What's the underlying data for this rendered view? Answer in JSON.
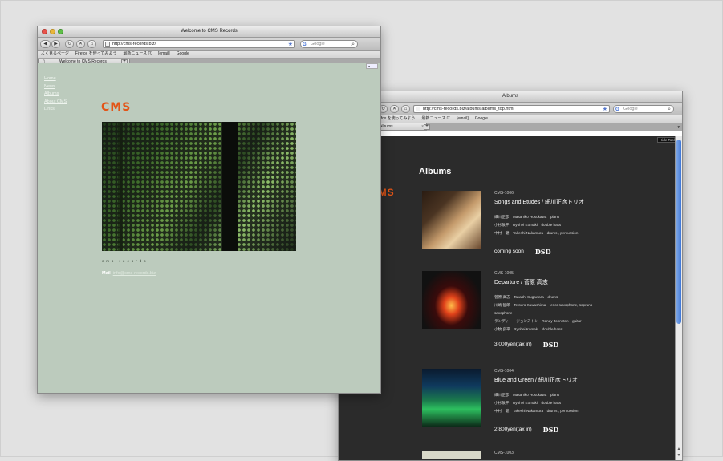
{
  "back_window": {
    "title": "Albums",
    "url": "http://cms-records.biz/albums/albums_top.html",
    "search_placeholder": "Google",
    "bookmarks": [
      "Firefox を使ってみよう",
      "最新ニュース ☈",
      "[email]",
      "Google"
    ],
    "tab_label": "Albums",
    "hide_tools": "Hide Tools",
    "heading": "Albums",
    "logo": "CMS",
    "albums": [
      {
        "catalog": "CMS-1006",
        "title": "Songs and Etudes / 細川正彦トリオ",
        "members": [
          "細川正彦　Masahiko Hosokawa　piano",
          "小杉敏平　Ryohei Komaki　double bass",
          "中村　健　Takeshi Nakamura　drums , percussion"
        ],
        "price": "coming soon",
        "dsd": "DSD"
      },
      {
        "catalog": "CMS-1005",
        "title": "Departure / 菅原 高志",
        "members": [
          "菅原 高志　Takashi Sugawara　drums",
          "川嶋 哲郎　Tetsuro Kawashima　tenor saxophone, soprano",
          "saxophone",
          "ランディー・ジョンストン　Randy Johnston　guitar",
          "小牧 良平　Ryohei Komaki　double bass"
        ],
        "price": "3,000yen(tax in)",
        "dsd": "DSD"
      },
      {
        "catalog": "CMS-1004",
        "title": "Blue and Green / 細川正彦トリオ",
        "members": [
          "細川正彦　Masahiko Hosokawa　piano",
          "小杉敏平　Ryohei Komaki　double bass",
          "中村　健　Takeshi Nakamura　drums , percussion"
        ],
        "price": "2,800yen(tax in)",
        "dsd": "DSD"
      },
      {
        "catalog": "CMS-1003"
      }
    ]
  },
  "front_window": {
    "title": "Welcome to CMS Records",
    "url": "http://cms-records.biz/",
    "search_placeholder": "Google",
    "bookmarks": [
      "よく見るページ",
      "Firefox を使ってみよう",
      "最新ニュース ☈",
      "[email]",
      "Google"
    ],
    "tab_label": "Welcome to CMS Records",
    "nav": [
      "Home",
      "News",
      "Albums",
      "About CMS",
      "Links"
    ],
    "logo": "CMS",
    "tagline": "cms records",
    "mail_label": "Mail",
    "mail_address": "info@cms-records.biz"
  },
  "colors": {
    "desktop_bg": "#e2e2e2",
    "front_content_bg": "#bccbbd",
    "back_content_bg": "#2b2b2b",
    "logo_orange": "#e35416"
  }
}
